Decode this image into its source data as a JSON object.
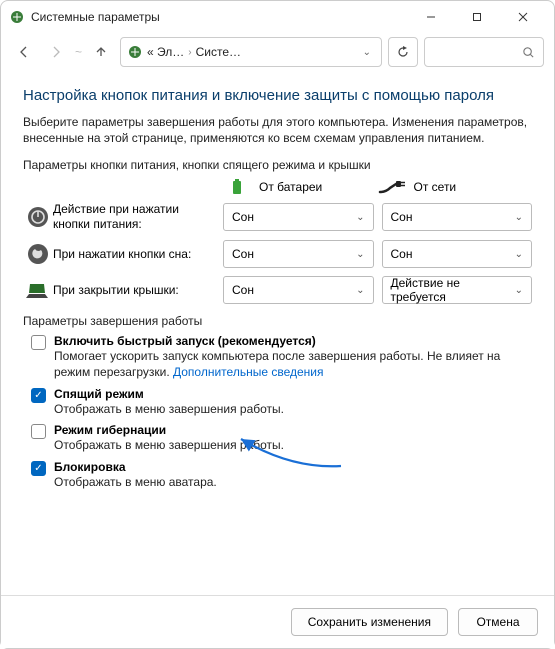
{
  "window": {
    "title": "Системные параметры"
  },
  "breadcrumb": {
    "seg1": "« Эл…",
    "seg2": "Систе…"
  },
  "page": {
    "heading": "Настройка кнопок питания и включение защиты с помощью пароля",
    "intro": "Выберите параметры завершения работы для этого компьютера. Изменения параметров, внесенные на этой странице, применяются ко всем схемам управления питанием.",
    "power_section_label": "Параметры кнопки питания, кнопки спящего режима и крышки",
    "col_battery": "От батареи",
    "col_ac": "От сети"
  },
  "rows": [
    {
      "label": "Действие при нажатии кнопки питания:",
      "battery": "Сон",
      "ac": "Сон"
    },
    {
      "label": "При нажатии кнопки сна:",
      "battery": "Сон",
      "ac": "Сон"
    },
    {
      "label": "При закрытии крышки:",
      "battery": "Сон",
      "ac": "Действие не требуется"
    }
  ],
  "shutdown": {
    "section_label": "Параметры завершения работы",
    "fast_title": "Включить быстрый запуск (рекомендуется)",
    "fast_desc_a": "Помогает ускорить запуск компьютера после завершения работы. Не влияет на режим перезагрузки. ",
    "fast_link": "Дополнительные сведения",
    "sleep_title": "Спящий режим",
    "sleep_desc": "Отображать в меню завершения работы.",
    "hib_title": "Режим гибернации",
    "hib_desc": "Отображать в меню завершения работы.",
    "lock_title": "Блокировка",
    "lock_desc": "Отображать в меню аватара."
  },
  "footer": {
    "save": "Сохранить изменения",
    "cancel": "Отмена"
  }
}
